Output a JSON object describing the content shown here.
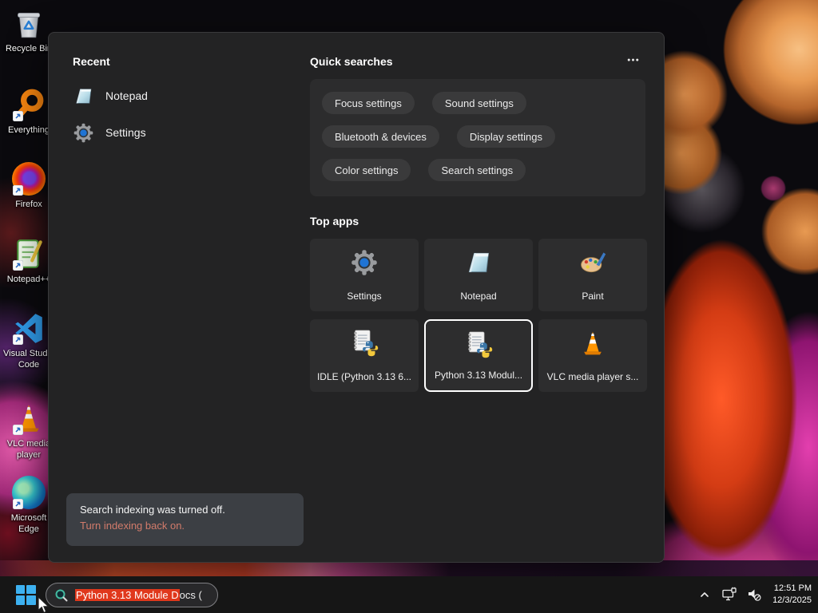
{
  "colors": {
    "selection_red": "#e0381c",
    "link_salmon": "#d27b6b",
    "windows_blue": "#3db1f0",
    "selected_tile_border": "#ffffff"
  },
  "desktop": {
    "icons": [
      {
        "name": "recycle-bin",
        "label": "Recycle Bin"
      },
      {
        "name": "everything",
        "label": "Everything"
      },
      {
        "name": "firefox",
        "label": "Firefox"
      },
      {
        "name": "notepad-plus-plus",
        "label": "Notepad++"
      },
      {
        "name": "visual-studio-code",
        "label": "Visual Studio\nCode"
      },
      {
        "name": "vlc-media-player",
        "label": "VLC media\nplayer"
      },
      {
        "name": "microsoft-edge",
        "label": "Microsoft\nEdge"
      }
    ]
  },
  "search_panel": {
    "recent": {
      "heading": "Recent",
      "items": [
        {
          "label": "Notepad",
          "icon": "notepad-icon"
        },
        {
          "label": "Settings",
          "icon": "settings-gear-icon"
        }
      ]
    },
    "quick_searches": {
      "heading": "Quick searches",
      "more_glyph": "●●●",
      "pills": [
        "Focus settings",
        "Sound settings",
        "Bluetooth & devices",
        "Display settings",
        "Color settings",
        "Search settings"
      ]
    },
    "top_apps": {
      "heading": "Top apps",
      "tiles": [
        {
          "label": "Settings",
          "icon": "settings-gear-icon",
          "selected": false
        },
        {
          "label": "Notepad",
          "icon": "notepad-icon",
          "selected": false
        },
        {
          "label": "Paint",
          "icon": "paint-icon",
          "selected": false
        },
        {
          "label": "IDLE (Python 3.13 6...",
          "icon": "python-doc-icon",
          "selected": false
        },
        {
          "label": "Python 3.13 Modul...",
          "icon": "python-doc-icon",
          "selected": true
        },
        {
          "label": "VLC media player s...",
          "icon": "vlc-cone-icon",
          "selected": false
        }
      ]
    },
    "notice": {
      "line1": "Search indexing was turned off.",
      "link": "Turn indexing back on."
    }
  },
  "taskbar": {
    "search": {
      "selected_text": "Python 3.13 Module D",
      "rest_text": "ocs ("
    },
    "tray": {
      "time": "12:51 PM",
      "date": "12/3/2025"
    }
  }
}
